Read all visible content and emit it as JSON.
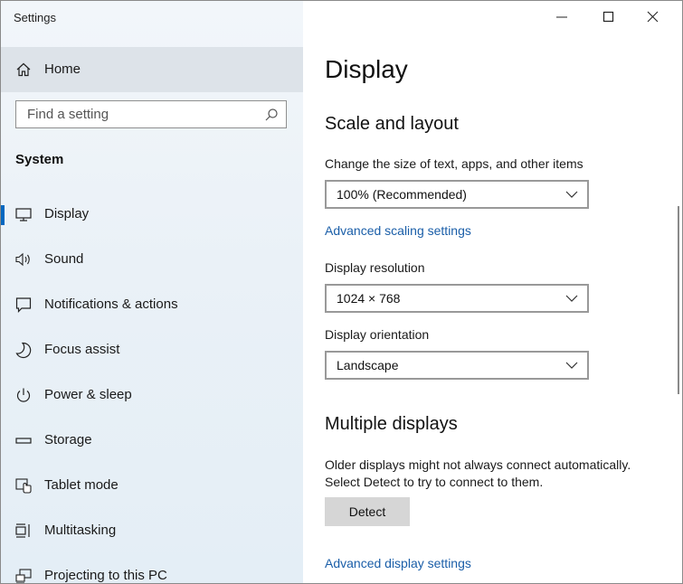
{
  "window": {
    "title": "Settings"
  },
  "sidebar": {
    "home_label": "Home",
    "search_placeholder": "Find a setting",
    "section_label": "System",
    "items": [
      {
        "label": "Display",
        "icon": "monitor-icon"
      },
      {
        "label": "Sound",
        "icon": "speaker-icon"
      },
      {
        "label": "Notifications & actions",
        "icon": "notification-icon"
      },
      {
        "label": "Focus assist",
        "icon": "moon-icon"
      },
      {
        "label": "Power & sleep",
        "icon": "power-icon"
      },
      {
        "label": "Storage",
        "icon": "storage-icon"
      },
      {
        "label": "Tablet mode",
        "icon": "tablet-mode-icon"
      },
      {
        "label": "Multitasking",
        "icon": "multitasking-icon"
      },
      {
        "label": "Projecting to this PC",
        "icon": "projecting-icon"
      }
    ],
    "active_item": "Display"
  },
  "main": {
    "title": "Display",
    "scale_section": {
      "heading": "Scale and layout",
      "scale_label": "Change the size of text, apps, and other items",
      "scale_value": "100% (Recommended)",
      "advanced_scaling_link": "Advanced scaling settings",
      "resolution_label": "Display resolution",
      "resolution_value": "1024 × 768",
      "orientation_label": "Display orientation",
      "orientation_value": "Landscape"
    },
    "multiple_section": {
      "heading": "Multiple displays",
      "description": "Older displays might not always connect automatically. Select Detect to try to connect to them.",
      "detect_button": "Detect",
      "advanced_display_link": "Advanced display settings"
    }
  },
  "colors": {
    "accent": "#0067c0",
    "link": "#1a5ea8"
  }
}
